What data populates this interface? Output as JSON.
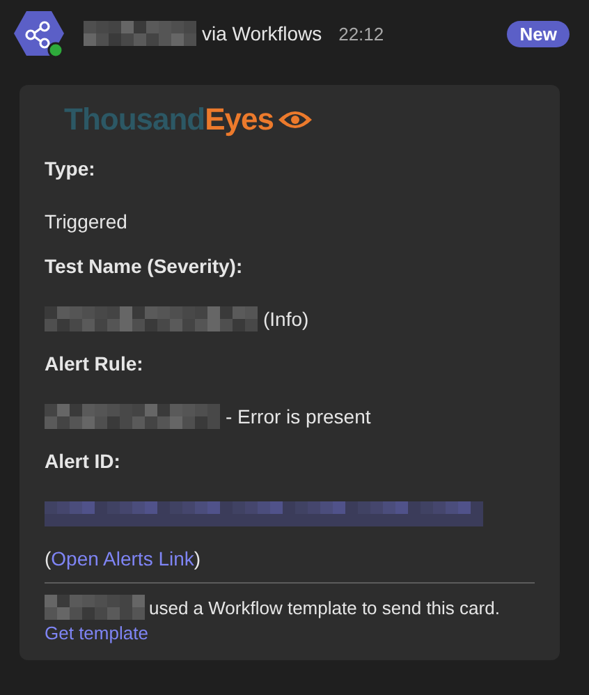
{
  "header": {
    "sender_suffix": "via Workflows",
    "time": "22:12",
    "badge": "New"
  },
  "card": {
    "logo": {
      "first": "Thousand",
      "second": "Eyes"
    },
    "fields": [
      {
        "label": "Type:",
        "kind": "text",
        "value": "Triggered"
      },
      {
        "label": "Test Name (Severity):",
        "kind": "redacted_prefix",
        "value": "(Info)"
      },
      {
        "label": "Alert Rule:",
        "kind": "redacted_prefix",
        "value": "- Error is present"
      },
      {
        "label": "Alert ID:",
        "kind": "redacted_link"
      }
    ],
    "link_line": {
      "open": "(",
      "link": "Open Alerts Link",
      "close": ")"
    },
    "footer": {
      "text": "used a Workflow template to send this card.",
      "link": "Get template"
    }
  }
}
